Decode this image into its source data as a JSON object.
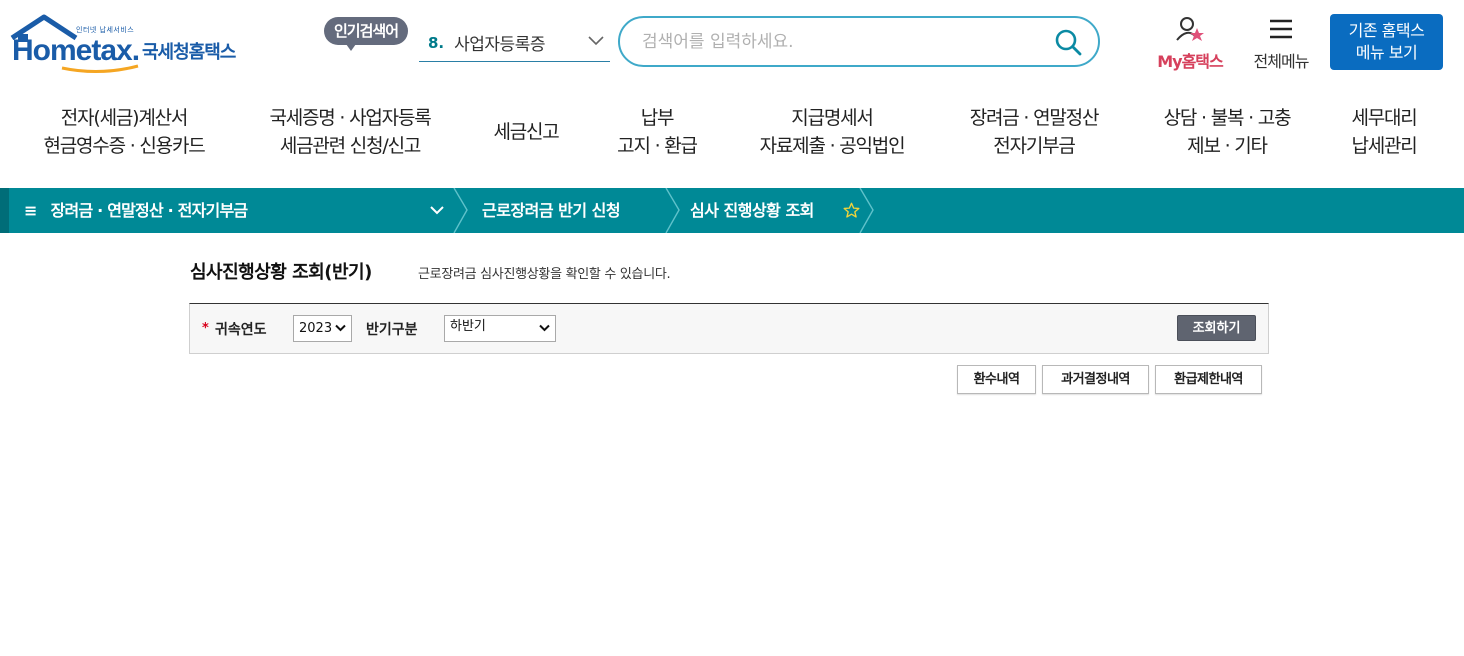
{
  "colors": {
    "brand_blue": "#1a5ca8",
    "teal_bar": "#008996",
    "myhome_pink": "#d6405c",
    "classic_blue": "#0a6cc0",
    "search_border": "#3fa9c9",
    "query_button": "#5f6470"
  },
  "header": {
    "logo": {
      "tagline": "인터넷 납세서비스",
      "word": "Hometax.",
      "name_ko": "국세청홈택스"
    },
    "popular": {
      "badge": "인기검색어",
      "rank": "8.",
      "keyword": "사업자등록증",
      "icon": "chevron-down-icon"
    },
    "search": {
      "placeholder": "검색어를 입력하세요.",
      "value": "",
      "icon": "search-icon"
    },
    "myhome": {
      "label": "My홈택스",
      "icon": "user-star-icon"
    },
    "allmenu": {
      "label": "전체메뉴",
      "icon": "hamburger-icon"
    },
    "classic": {
      "line1": "기존 홈택스",
      "line2": "메뉴 보기"
    }
  },
  "gnb": [
    {
      "line1": "전자(세금)계산서",
      "line2": "현금영수증 · 신용카드"
    },
    {
      "line1": "국세증명 · 사업자등록",
      "line2": "세금관련 신청/신고"
    },
    {
      "line1": "세금신고",
      "line2": ""
    },
    {
      "line1": "납부",
      "line2": "고지 · 환급"
    },
    {
      "line1": "지급명세서",
      "line2": "자료제출 · 공익법인"
    },
    {
      "line1": "장려금 · 연말정산",
      "line2": "전자기부금"
    },
    {
      "line1": "상담 · 불복 · 고충",
      "line2": "제보 · 기타"
    },
    {
      "line1": "세무대리",
      "line2": "납세관리"
    }
  ],
  "location": {
    "menu_icon": "menu-bars-icon",
    "current_menu": "장려금 · 연말정산 · 전자기부금",
    "crumb1": "근로장려금 반기 신청",
    "crumb2": "심사 진행상황 조회",
    "star_icon": "favorite-star-icon"
  },
  "page": {
    "title": "심사진행상황 조회(반기)",
    "description": "근로장려금 심사진행상황을 확인할 수 있습니다."
  },
  "filter": {
    "required_mark": "*",
    "year_label": "귀속연도",
    "year_value": "2023",
    "half_label": "반기구분",
    "half_value": "하반기",
    "query_button": "조회하기"
  },
  "actions": {
    "refund_history": "환수내역",
    "past_decisions": "과거결정내역",
    "refund_limit": "환급제한내역"
  }
}
